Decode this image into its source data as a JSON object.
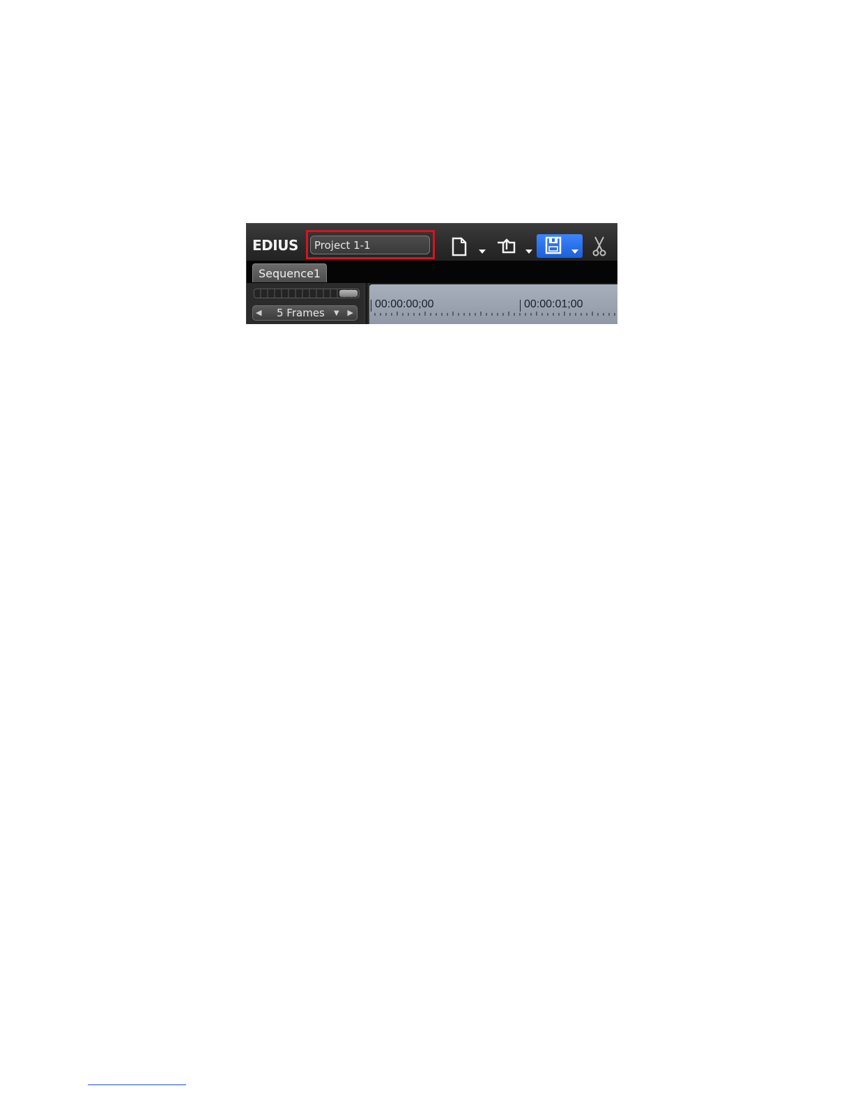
{
  "app": {
    "logo": "EDIUS"
  },
  "project": {
    "name": "Project 1-1"
  },
  "toolbar": {
    "buttons": [
      {
        "name": "new-project",
        "icon": "new-document-icon"
      },
      {
        "name": "new-project-menu",
        "icon": "dropdown-arrow-icon"
      },
      {
        "name": "open-project",
        "icon": "open-folder-icon"
      },
      {
        "name": "open-project-menu",
        "icon": "dropdown-arrow-icon"
      },
      {
        "name": "save-project",
        "icon": "floppy-disk-icon"
      },
      {
        "name": "cut",
        "icon": "scissors-icon"
      }
    ]
  },
  "tabs": [
    {
      "label": "Sequence1",
      "active": true
    }
  ],
  "timeline": {
    "scale": "5 Frames",
    "timecodes": [
      "00:00:00;00",
      "00:00:01;00"
    ]
  },
  "colors": {
    "highlight": "#d8141e",
    "save_button": "#2a6ff0",
    "ruler": "#9aa2ae"
  }
}
